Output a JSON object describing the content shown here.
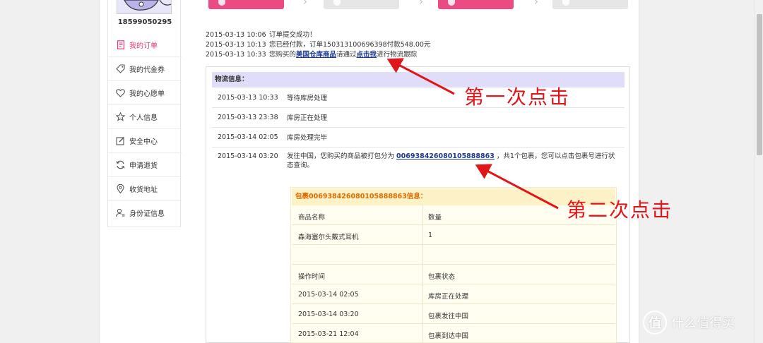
{
  "user": {
    "id": "18599050295"
  },
  "sidebar": {
    "items": [
      {
        "label": "我的订单",
        "icon": "order-doc-icon"
      },
      {
        "label": "我的代金券",
        "icon": "tag-icon"
      },
      {
        "label": "我的心愿单",
        "icon": "heart-icon"
      },
      {
        "label": "个人信息",
        "icon": "star-icon"
      },
      {
        "label": "安全中心",
        "icon": "edit-icon"
      },
      {
        "label": "申请退货",
        "icon": "refresh-icon"
      },
      {
        "label": "收货地址",
        "icon": "map-pin-icon"
      },
      {
        "label": "身份证信息",
        "icon": "id-user-icon"
      }
    ]
  },
  "log": [
    {
      "time": "2015-03-13 10:06",
      "text": "订单提交成功！"
    },
    {
      "time": "2015-03-13 10:13",
      "text": "您已经付款，订单150313100696398付款548.00元"
    },
    {
      "time": "2015-03-13 10:33",
      "pre": "您购买的",
      "link1": "美国仓库商品",
      "mid": "请通过",
      "link2": "点击我",
      "post": "进行物流跟踪"
    }
  ],
  "logistics": {
    "title": "物流信息：",
    "rows": [
      {
        "time": "2015-03-13 10:33",
        "desc": "等待库房处理"
      },
      {
        "time": "2015-03-13 23:38",
        "desc": "库房正在处理"
      },
      {
        "time": "2015-03-14 02:05",
        "desc": "库房处理完毕"
      },
      {
        "time": "2015-03-14 03:20",
        "pre": "发往中国，您购买的商品被打包分为 ",
        "link": "0069384260801058886З",
        "post": " ，共1个包裹，您可以点击包裹号进行状态查询。"
      }
    ]
  },
  "package": {
    "title": "包裹006938426080105888863信息：",
    "header": [
      "商品名称",
      "数量"
    ],
    "items": [
      [
        "森海塞尔头戴式耳机",
        "1"
      ]
    ],
    "status_header": [
      "操作时间",
      "包裹状态"
    ],
    "status": [
      [
        "2015-03-14 02:05",
        "库房正在处理"
      ],
      [
        "2015-03-14 03:20",
        "包裹发往中国"
      ],
      [
        "2015-03-21 12:04",
        "包裹到达中国"
      ]
    ]
  },
  "annotations": {
    "first": "第一次点击",
    "second": "第二次点击"
  },
  "watermark": {
    "logo": "值",
    "text": "什么值得买"
  },
  "colors": {
    "accent": "#e4397a",
    "annotation": "#e0161b",
    "link": "#1b3a8c"
  }
}
